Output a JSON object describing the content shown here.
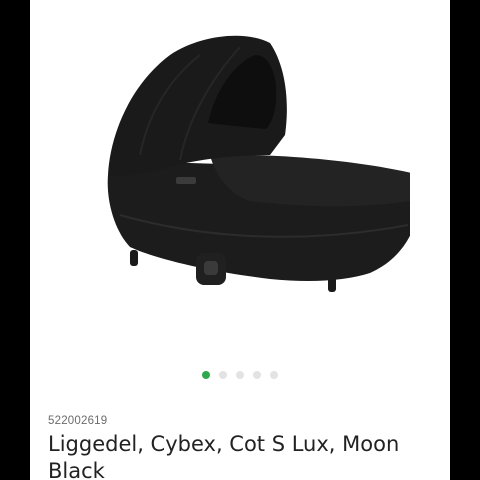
{
  "product": {
    "sku": "522002619",
    "title": "Liggedel, Cybex, Cot S Lux, Moon Black",
    "image_icon": "carrycot-product-image"
  },
  "carousel": {
    "slides": [
      {
        "active": true
      },
      {
        "active": false
      },
      {
        "active": false
      },
      {
        "active": false
      },
      {
        "active": false
      }
    ]
  },
  "colors": {
    "active_dot": "#2ea84a",
    "inactive_dot": "#e3e3e3",
    "product": "#1e1e1e"
  }
}
